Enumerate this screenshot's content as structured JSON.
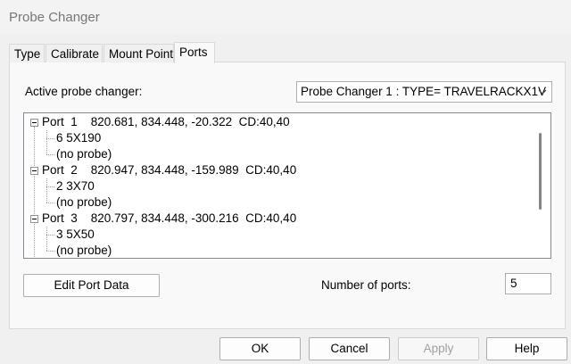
{
  "window": {
    "title": "Probe Changer"
  },
  "tabs": [
    {
      "label": "Type",
      "active": false
    },
    {
      "label": "Calibrate",
      "active": false
    },
    {
      "label": "Mount Point",
      "active": false
    },
    {
      "label": "Ports",
      "active": true
    }
  ],
  "active_changer": {
    "label": "Active probe changer:",
    "value": "Probe Changer 1 : TYPE= TRAVELRACKX1V"
  },
  "ports": [
    {
      "text": "Port  1    820.681, 834.448, -20.322  CD:40,40",
      "children": [
        "6 5X190",
        "(no probe)"
      ]
    },
    {
      "text": "Port  2    820.947, 834.448, -159.989  CD:40,40",
      "children": [
        "2 3X70",
        "(no probe)"
      ]
    },
    {
      "text": "Port  3    820.797, 834.448, -300.216  CD:40,40",
      "children": [
        "3 5X50",
        "(no probe)"
      ]
    }
  ],
  "edit_button": "Edit Port Data",
  "num_ports": {
    "label": "Number of ports:",
    "value": "5"
  },
  "buttons": {
    "ok": "OK",
    "cancel": "Cancel",
    "apply": "Apply",
    "help": "Help"
  }
}
